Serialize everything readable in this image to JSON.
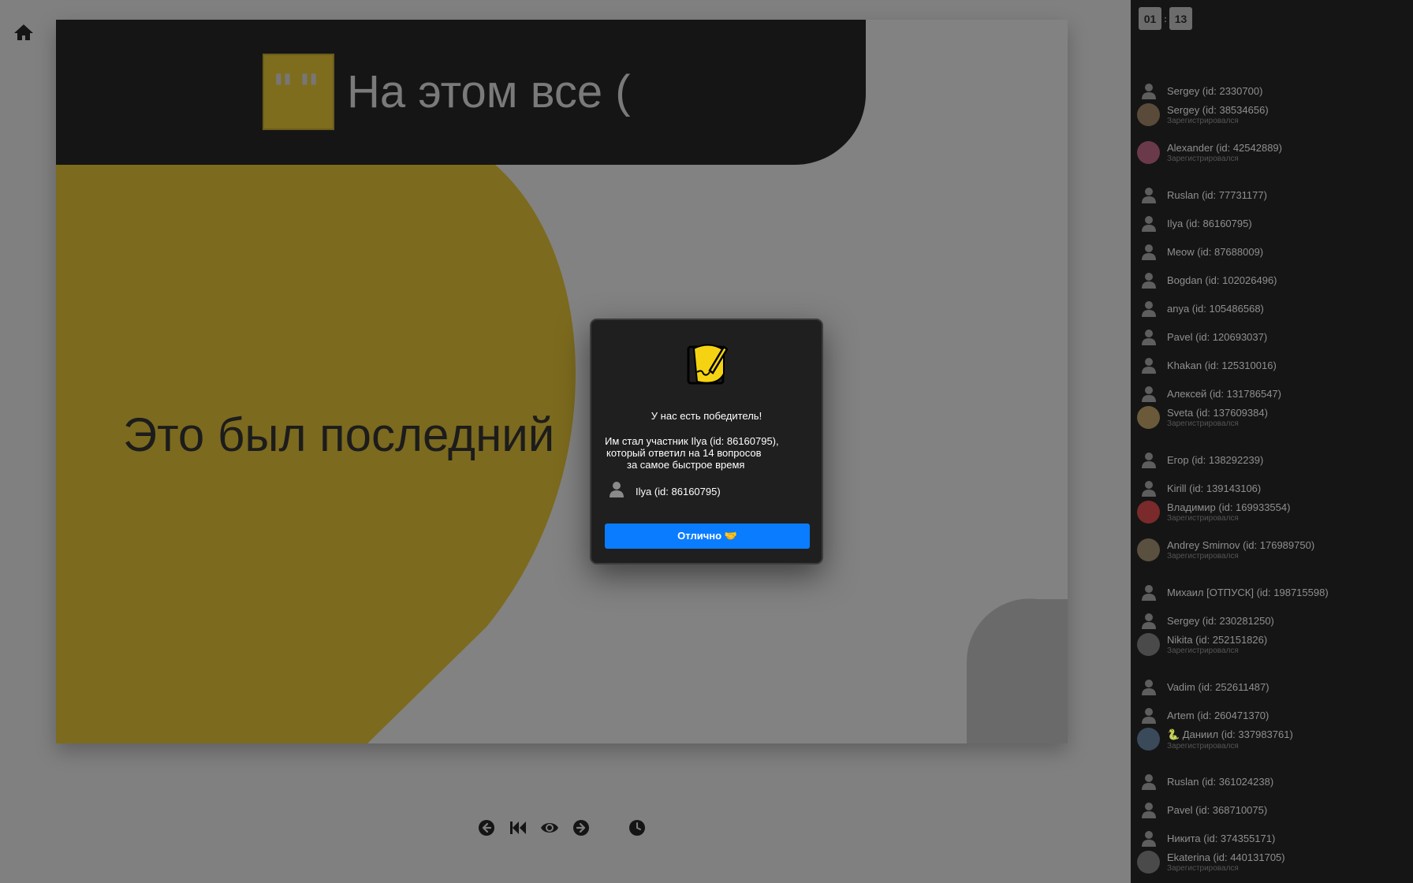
{
  "slide": {
    "title": "На этом все (",
    "badge_text": "\"\"",
    "body": "Это был последний"
  },
  "timer": {
    "minutes": "01",
    "seconds": "13"
  },
  "participants": [
    {
      "name": "Sergey (id: 2330700)",
      "avatar": "default"
    },
    {
      "name": "Sergey (id: 38534656)",
      "status": "Зарегистрировался",
      "avatar": "photo"
    },
    {
      "name": "Alexander (id: 42542889)",
      "status": "Зарегистрировался",
      "avatar": "photo"
    },
    {
      "name": "Ruslan (id: 77731177)",
      "avatar": "default"
    },
    {
      "name": "Ilya (id: 86160795)",
      "avatar": "default"
    },
    {
      "name": "Meow (id: 87688009)",
      "avatar": "default"
    },
    {
      "name": "Bogdan (id: 102026496)",
      "avatar": "default"
    },
    {
      "name": "anya (id: 105486568)",
      "avatar": "default"
    },
    {
      "name": "Pavel (id: 120693037)",
      "avatar": "default"
    },
    {
      "name": "Khakan (id: 125310016)",
      "avatar": "default"
    },
    {
      "name": "Алексей (id: 131786547)",
      "avatar": "default"
    },
    {
      "name": "Sveta (id: 137609384)",
      "status": "Зарегистрировался",
      "avatar": "photo"
    },
    {
      "name": "Егор (id: 138292239)",
      "avatar": "default"
    },
    {
      "name": "Kirill (id: 139143106)",
      "avatar": "default"
    },
    {
      "name": "Владимир (id: 169933554)",
      "status": "Зарегистрировался",
      "avatar": "photo"
    },
    {
      "name": "Andrey Smirnov (id: 176989750)",
      "status": "Зарегистрировался",
      "avatar": "photo"
    },
    {
      "name": "Михаил [ОТПУСК] (id: 198715598)",
      "avatar": "default"
    },
    {
      "name": "Sergey (id: 230281250)",
      "avatar": "default"
    },
    {
      "name": "Nikita (id: 252151826)",
      "status": "Зарегистрировался",
      "avatar": "photo"
    },
    {
      "name": "Vadim (id: 252611487)",
      "avatar": "default"
    },
    {
      "name": "Artem (id: 260471370)",
      "avatar": "default"
    },
    {
      "name": "🐍 Даниил (id: 337983761)",
      "status": "Зарегистрировался",
      "avatar": "photo"
    },
    {
      "name": "Ruslan (id: 361024238)",
      "avatar": "default"
    },
    {
      "name": "Pavel (id: 368710075)",
      "avatar": "default"
    },
    {
      "name": "Никита (id: 374355171)",
      "avatar": "default"
    },
    {
      "name": "Ekaterina (id: 440131705)",
      "status": "Зарегистрировался",
      "avatar": "photo"
    }
  ],
  "modal": {
    "title": "У нас есть победитель!",
    "line1": "Им стал участник Ilya (id: 86160795),",
    "line2": "который ответил на 14 вопросов",
    "line3": "за самое быстрое время",
    "winner": "Ilya (id: 86160795)",
    "button": "Отлично 🤝"
  },
  "icons": {
    "home": "home-icon",
    "prev": "arrow-left-icon",
    "first": "skip-back-icon",
    "preview": "eye-icon",
    "next": "arrow-right-icon",
    "timer": "clock-icon",
    "avatar": "user-icon",
    "winner": "notepad-pencil-icon"
  },
  "colors": {
    "accent_yellow": "#7f6d1e",
    "button_blue": "#0a7cff",
    "sidebar_bg": "#151515",
    "modal_bg": "#1f1f1f"
  }
}
